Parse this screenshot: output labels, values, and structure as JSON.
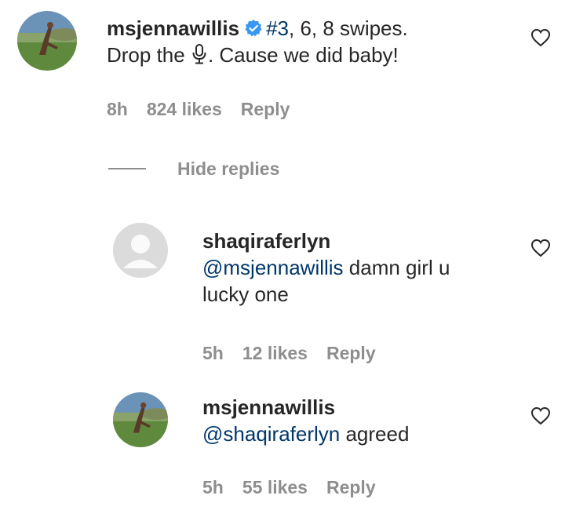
{
  "comments": [
    {
      "username": "msjennawillis",
      "tag": "#3",
      "text_part1": ", 6, 8 swipes.",
      "text_part2_before": "Drop the ",
      "text_part2_after": ". Cause we did baby!",
      "mic_icon": "microphone-icon",
      "time": "8h",
      "likes": "824 likes",
      "reply": "Reply"
    }
  ],
  "hide_replies": "Hide replies",
  "replies": [
    {
      "username": "shaqiraferlyn",
      "mention": "@msjennawillis",
      "text": " damn girl u",
      "text2": "lucky one",
      "time": "5h",
      "likes": "12 likes",
      "reply": "Reply"
    },
    {
      "username": "msjennawillis",
      "mention": "@shaqiraferlyn",
      "text": " agreed",
      "time": "5h",
      "likes": "55 likes",
      "reply": "Reply"
    }
  ],
  "colors": {
    "link": "#00376b",
    "verified": "#3897f0",
    "meta": "#8e8e8e"
  }
}
